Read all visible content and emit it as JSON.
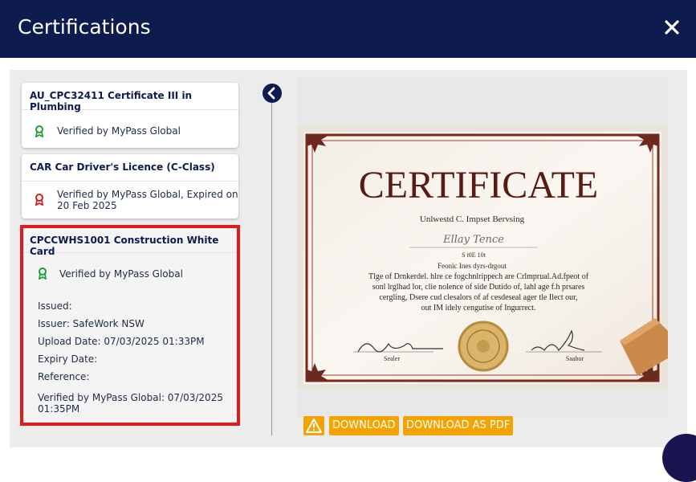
{
  "dialog": {
    "title": "Certifications"
  },
  "certificates": [
    {
      "title": "AU_CPC32411 Certificate III in Plumbing",
      "status_line1": "Verified by MyPass Global",
      "status_line2": "",
      "status_color": "#1e9e3a"
    },
    {
      "title": "CAR Car Driver's Licence (C-Class)",
      "status_line1": "Verified by MyPass Global, Expired on",
      "status_line2": "20 Feb 2025",
      "status_color": "#e01b1b"
    }
  ],
  "selected": {
    "title": "CPCCWHS1001 Construction White Card",
    "status": "Verified by MyPass Global",
    "status_color": "#1e9e3a",
    "issued": "Issued:",
    "issuer": "Issuer: SafeWork NSW",
    "upload_date": "Upload Date: 07/03/2025 01:33PM",
    "expiry_date": "Expiry Date:",
    "reference": "Reference:",
    "verified_line1": "Verified by MyPass Global: 07/03/2025",
    "verified_line2": "01:35PM"
  },
  "certificate_image": {
    "heading": "CERTIFICATE",
    "line1": "Unlwestd C. Impset Bervsing",
    "signature": "Ellay Tence",
    "line2": "S  t0E  10t",
    "line3": "Feonic Ines dyrs-drgout",
    "para1": "Tlge of Drnkerdel. hlre ce fogchnlrippech are Crlmprual.Ad.fpeot of",
    "para2": "sonl lrglhad lor, clie nolence of side Dutido of, lahl age f.h prsares",
    "para3": "cergling, Dsere cud clesalors of af cesdeseal ager tle Ilect our,",
    "para4": "out IM idely cengutise of Ingurrect.",
    "sig_left": "Sealer",
    "sig_right": "Saahor"
  },
  "actions": {
    "download": "DOWNLOAD",
    "download_pdf": "DOWNLOAD AS PDF"
  },
  "colors": {
    "header": "#0d1b4f",
    "accent": "#f5a300",
    "selection_border": "#e01b1b"
  }
}
